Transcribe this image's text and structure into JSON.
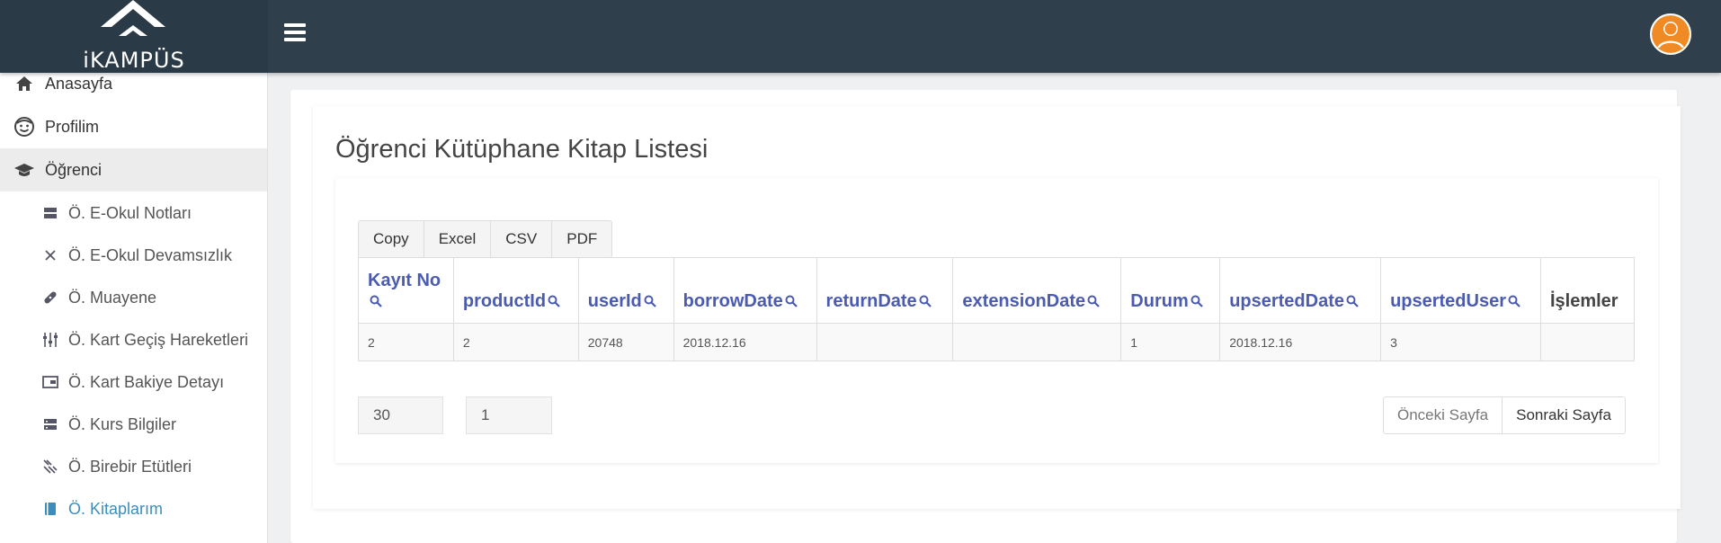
{
  "header": {
    "logo_text": "iKAMPÜS",
    "menu_icon": "hamburger-icon",
    "user_icon": "user-avatar-icon"
  },
  "sidebar": {
    "items": [
      {
        "label": "Anasayfa",
        "icon": "home-icon"
      },
      {
        "label": "Profilim",
        "icon": "smiley-face-icon"
      },
      {
        "label": "Öğrenci",
        "icon": "graduation-cap-icon"
      }
    ],
    "subitems": [
      {
        "label": "Ö. E-Okul Notları",
        "icon": "server-icon"
      },
      {
        "label": "Ö. E-Okul Devamsızlık",
        "icon": "x-icon"
      },
      {
        "label": "Ö. Muayene",
        "icon": "bandage-icon"
      },
      {
        "label": "Ö. Kart Geçiş Hareketleri",
        "icon": "sliders-icon"
      },
      {
        "label": "Ö. Kart Bakiye Detayı",
        "icon": "wallet-icon"
      },
      {
        "label": "Ö. Kurs Bilgiler",
        "icon": "list-icon"
      },
      {
        "label": "Ö. Birebir Etütleri",
        "icon": "pencil-icon"
      },
      {
        "label": "Ö. Kitaplarım",
        "icon": "book-icon"
      }
    ]
  },
  "main": {
    "title": "Öğrenci Kütüphane Kitap Listesi",
    "export_buttons": [
      "Copy",
      "Excel",
      "CSV",
      "PDF"
    ],
    "table": {
      "columns": [
        "Kayıt No",
        "productId",
        "userId",
        "borrowDate",
        "returnDate",
        "extensionDate",
        "Durum",
        "upsertedDate",
        "upsertedUser",
        "İşlemler"
      ],
      "rows": [
        [
          "2",
          "2",
          "20748",
          "2018.12.16",
          "",
          "",
          "1",
          "2018.12.16",
          "3",
          ""
        ]
      ]
    },
    "pagination": {
      "page_size": "30",
      "page_number": "1",
      "prev_label": "Önceki Sayfa",
      "next_label": "Sonraki Sayfa"
    }
  },
  "colors": {
    "topbar": "#2f3f4c",
    "header_link": "#4a5bb0",
    "active_link": "#3c8dbc",
    "avatar": "#f08a24"
  }
}
